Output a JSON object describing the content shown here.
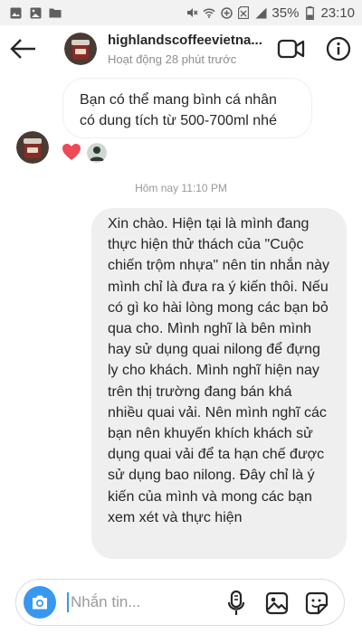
{
  "status_bar": {
    "battery_percent": "35%",
    "time": "23:10",
    "icons": [
      "image-icon",
      "gallery-icon",
      "folder-icon",
      "mute-icon",
      "wifi-icon",
      "data-saver-icon",
      "no-sim-icon",
      "signal-icon",
      "battery-icon"
    ]
  },
  "header": {
    "username": "highlandscoffeevietna...",
    "activity": "Hoạt động 28 phút trước",
    "icons": [
      "back-arrow-icon",
      "video-call-icon",
      "info-icon"
    ]
  },
  "messages": {
    "incoming_text": "Bạn có thể mang bình cá nhân có dung tích từ 500-700ml nhé",
    "reaction": "heart",
    "timestamp": "Hôm nay 11:10 PM",
    "outgoing_text": "Xin chào. Hiện tại là mình đang thực hiện thử thách của \"Cuộc chiến trộm nhựa\" nên tin nhắn này mình chỉ là đưa ra ý kiến thôi. Nếu có gì ko hài lòng mong các bạn bỏ qua cho. Mình nghĩ là bên mình hay sử dụng quai nilong để đựng ly cho khách. Mình nghĩ hiện nay trên thị trường đang bán khá nhiều quai vải. Nên mình nghĩ các bạn nên khuyến khích khách sử dụng quai vải để ta hạn chế được sử dụng bao nilong. Đây chỉ là ý kiến của mình và mong các bạn xem xét và thực hiện"
  },
  "composer": {
    "placeholder": "Nhắn tin...",
    "value": "",
    "icons": [
      "camera-icon",
      "microphone-icon",
      "gallery-icon",
      "sticker-icon"
    ]
  },
  "colors": {
    "accent": "#3897f0",
    "bubble_out": "#efefef",
    "heart": "#ed4956"
  }
}
